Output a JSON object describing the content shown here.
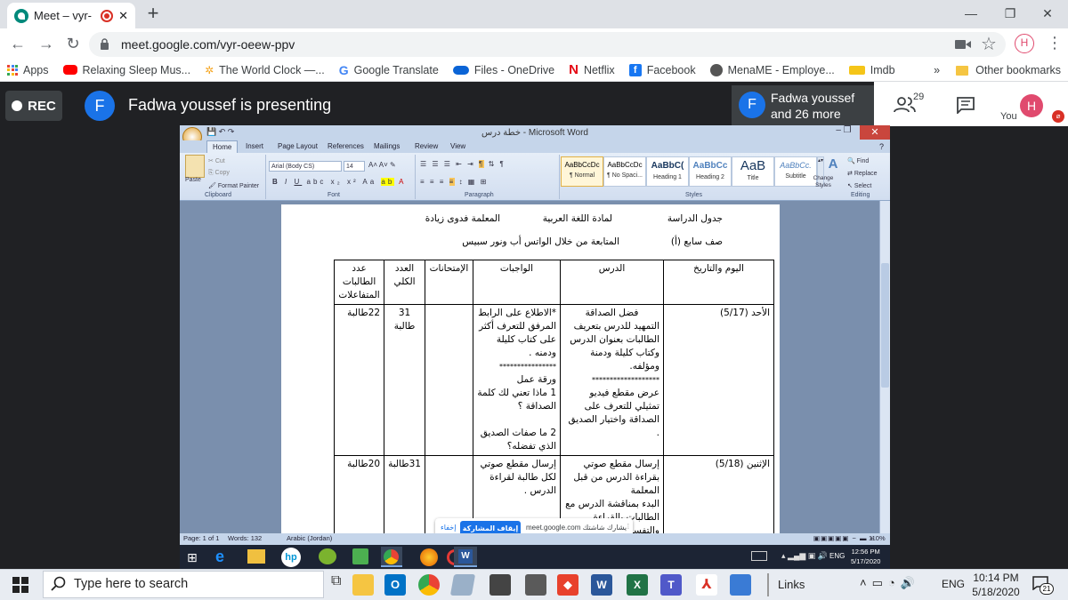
{
  "browser": {
    "tab_title": "Meet – vyr-",
    "new_tab": "+",
    "url": "meet.google.com/vyr-oeew-ppv",
    "avatar_letter": "H",
    "window_controls": [
      "—",
      "❐",
      "✕"
    ]
  },
  "bookmarks": {
    "items": [
      {
        "label": "Apps",
        "color": "#4285f4"
      },
      {
        "label": "Relaxing Sleep Mus...",
        "color": "#ff0000"
      },
      {
        "label": "The World Clock —...",
        "color": "#f5a623"
      },
      {
        "label": "Google Translate",
        "color": "#4285f4"
      },
      {
        "label": "Files - OneDrive",
        "color": "#0a64d6"
      },
      {
        "label": "Netflix",
        "color": "#e50914"
      },
      {
        "label": "Facebook",
        "color": "#1877f2"
      },
      {
        "label": "MenaME - Employe...",
        "color": "#444444"
      },
      {
        "label": "Imdb",
        "color": "#f5c518"
      }
    ],
    "overflow": "»",
    "other": "Other bookmarks"
  },
  "meet": {
    "rec_label": "REC",
    "presenter_initial": "F",
    "presenting_text": "Fadwa youssef is presenting",
    "tile_initial": "F",
    "tile_name_line1": "Fadwa youssef",
    "tile_name_line2": "and 26 more",
    "participants_count": "29",
    "self_initial": "H",
    "self_label": "You"
  },
  "word": {
    "title": "خطة درس - Microsoft Word",
    "tabs": [
      "Home",
      "Insert",
      "Page Layout",
      "References",
      "Mailings",
      "Review",
      "View"
    ],
    "clipboard": {
      "paste": "Paste",
      "cut": "Cut",
      "copy": "Copy",
      "format_painter": "Format Painter",
      "label": "Clipboard"
    },
    "font": {
      "name": "Arial (Body CS)",
      "size": "14",
      "label": "Font"
    },
    "paragraph_label": "Paragraph",
    "styles": [
      {
        "preview": "AaBbCcDc",
        "name": "¶ Normal"
      },
      {
        "preview": "AaBbCcDc",
        "name": "¶ No Spaci..."
      },
      {
        "preview": "AaBbC(",
        "name": "Heading 1"
      },
      {
        "preview": "AaBbCc",
        "name": "Heading 2"
      },
      {
        "preview": "AaB",
        "name": "Title"
      },
      {
        "preview": "AaBbCc.",
        "name": "Subtitle"
      }
    ],
    "change_styles": "Change Styles",
    "styles_label": "Styles",
    "editing": {
      "find": "Find",
      "replace": "Replace",
      "select": "Select",
      "label": "Editing"
    },
    "status": {
      "page": "Page: 1 of 1",
      "words": "Words: 132",
      "language": "Arabic (Jordan)",
      "zoom": "110%"
    }
  },
  "document": {
    "header_line1_a": "جدول الدراسة",
    "header_line1_b": "لمادة اللغة العربية",
    "header_line1_c": "المعلمة فدوى زيادة",
    "header_line2_a": "صف سابع (أ)",
    "header_line2_b": "المتابعة من خلال الواتس أب ونور سبيس",
    "columns": [
      "اليوم والتاريخ",
      "الدرس",
      "الواجبات",
      "الإمتحانات",
      "العدد الكلي",
      "عدد الطالبات المتفاعلات"
    ],
    "rows": [
      {
        "day": "الأحد (5/17)",
        "lesson": [
          "فضل الصداقة",
          "التمهيد للدرس بتعريف الطالبات بعنوان الدرس وكتاب كليلة ودمنة ومؤلفه.",
          "*******************",
          "عرض مقطع فيديو تمثيلي للتعرف على الصداقة واختيار الصديق ."
        ],
        "homework": [
          "*الاطلاع على الرابط المرفق للتعرف أكثر على كتاب كليلة ودمنه .",
          "****************",
          "ورقة عمل",
          "1 ماذا تعني لك كلمة الصداقة ؟",
          "",
          "2 ما صفات الصديق الذي تفضله؟"
        ],
        "exams": "",
        "total": "31 طالبة",
        "interacting": "22طالبة"
      },
      {
        "day": "الإثنين (5/18)",
        "lesson": [
          "إرسال مقطع صوتي بقراءة الدرس من قبل المعلمة",
          "البدء بمناقشة الدرس مع الطالبات بالقراءة والتفسير"
        ],
        "homework": [
          "إرسال مقطع صوتي لكل طالبة لقراءة الدرس ."
        ],
        "exams": "",
        "total": "31طالبة",
        "interacting": "20طالبة"
      }
    ]
  },
  "share_pill": {
    "message": "يشارك شاشتك meet.google.com",
    "stop": "إيقاف المشاركة",
    "hide": "إخفاء"
  },
  "inner_taskbar": {
    "lang": "ENG",
    "time": "12:56 PM",
    "date": "5/17/2020"
  },
  "taskbar": {
    "search_placeholder": "Type here to search",
    "links": "Links",
    "lang": "ENG",
    "time": "10:14 PM",
    "date": "5/18/2020",
    "notifications": "21"
  }
}
